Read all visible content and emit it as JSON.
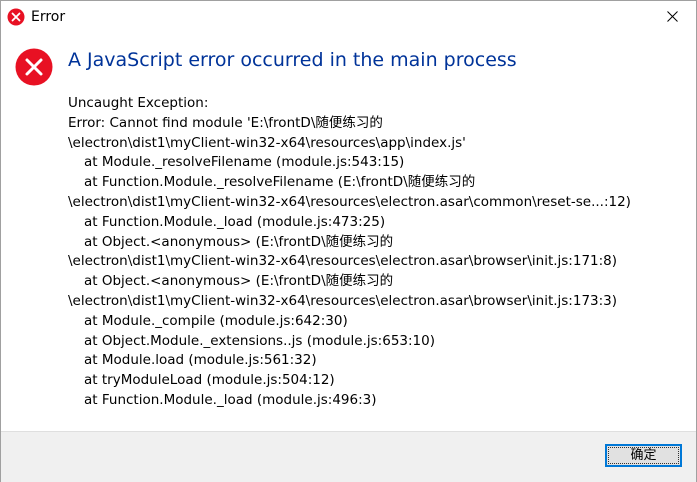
{
  "window": {
    "title": "Error",
    "accent_color": "#003399",
    "error_icon_color": "#e81123",
    "title_icon": "error-icon",
    "close_icon": "close-icon"
  },
  "dialog": {
    "heading": "A JavaScript error occurred in the main process",
    "message_lines": [
      "Uncaught Exception:",
      "Error: Cannot find module 'E:\\frontD\\随便练习的",
      "\\electron\\dist1\\myClient-win32-x64\\resources\\app\\index.js'",
      "at Module._resolveFilename (module.js:543:15)",
      "at Function.Module._resolveFilename (E:\\frontD\\随便练习的",
      "\\electron\\dist1\\myClient-win32-x64\\resources\\electron.asar\\common\\reset-se...:12)",
      "at Function.Module._load (module.js:473:25)",
      "at Object.<anonymous> (E:\\frontD\\随便练习的",
      "\\electron\\dist1\\myClient-win32-x64\\resources\\electron.asar\\browser\\init.js:171:8)",
      "at Object.<anonymous> (E:\\frontD\\随便练习的",
      "\\electron\\dist1\\myClient-win32-x64\\resources\\electron.asar\\browser\\init.js:173:3)",
      "at Module._compile (module.js:642:30)",
      "at Object.Module._extensions..js (module.js:653:10)",
      "at Module.load (module.js:561:32)",
      "at tryModuleLoad (module.js:504:12)",
      "at Function.Module._load (module.js:496:3)"
    ],
    "ok_label": "确定"
  }
}
